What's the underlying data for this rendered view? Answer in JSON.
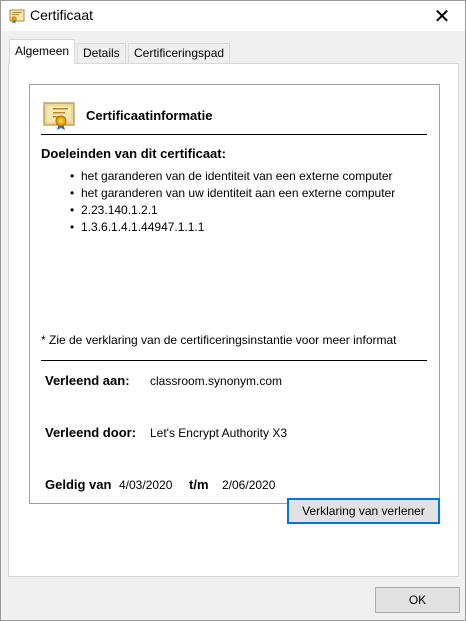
{
  "window": {
    "title": "Certificaat",
    "close_symbol": "✕"
  },
  "tabs": [
    {
      "label": "Algemeen",
      "active": true
    },
    {
      "label": "Details",
      "active": false
    },
    {
      "label": "Certificeringspad",
      "active": false
    }
  ],
  "info": {
    "icon": "certificate-icon",
    "heading": "Certificaatinformatie",
    "purposes_title": "Doeleinden van dit certificaat:",
    "purposes": [
      "het garanderen van de identiteit van een externe computer",
      "het garanderen van uw identiteit aan een externe computer",
      "2.23.140.1.2.1",
      "1.3.6.1.4.1.44947.1.1.1"
    ],
    "footnote": "* Zie de verklaring van de certificeringsinstantie voor meer informat",
    "issued_to_label": "Verleend aan:",
    "issued_to_value": "classroom.synonym.com",
    "issued_by_label": "Verleend door:",
    "issued_by_value": "Let's Encrypt Authority X3",
    "valid_from_label": "Geldig van",
    "valid_from_value": "4/03/2020",
    "valid_to_label": "t/m",
    "valid_to_value": "2/06/2020"
  },
  "buttons": {
    "issuer_statement": "Verklaring van verlener",
    "ok": "OK"
  },
  "colors": {
    "accent": "#0078d7",
    "window_bg": "#f0f0f0",
    "button_bg": "#e1e1e1"
  }
}
